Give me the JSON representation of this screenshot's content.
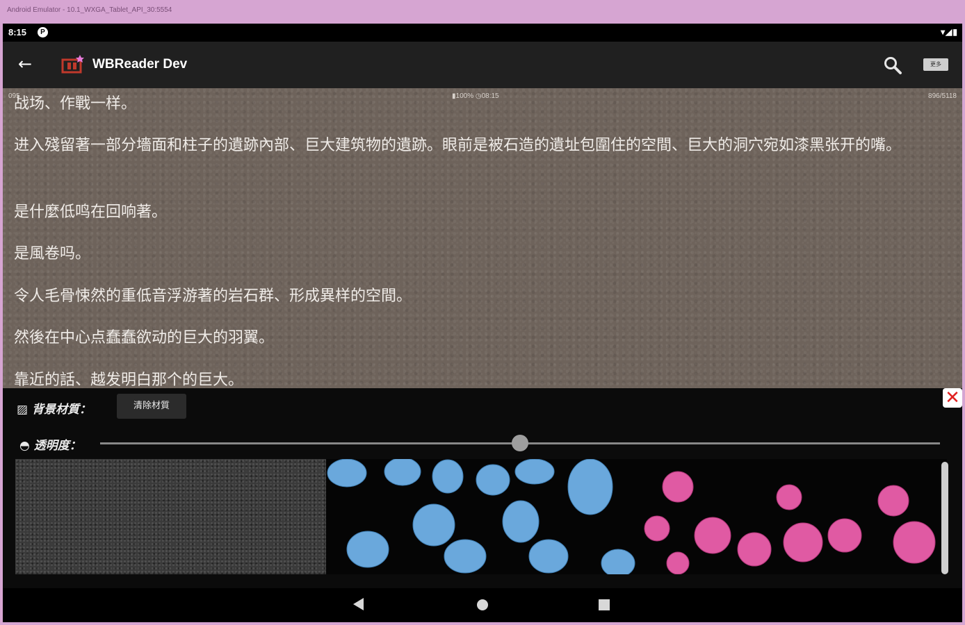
{
  "window": {
    "title": "Android Emulator - 10.1_WXGA_Tablet_API_30:5554"
  },
  "statusbar": {
    "time": "8:15",
    "notification_icon": "P",
    "system_icons": "▾◢▮"
  },
  "appbar": {
    "back_icon": "arrow-left-icon",
    "title": "WBReader Dev",
    "search_icon": "search-icon",
    "more_label": "更多"
  },
  "reader": {
    "meta_left": "095",
    "meta_center": "▮100% ◷08:15",
    "meta_right": "896/5118",
    "paragraphs": [
      "战场、作戰一样。",
      "进入殘留著一部分墻面和柱子的遺跡內部、巨大建筑物的遺跡。眼前是被石造的遺址包圍住的空間、巨大的洞穴宛如漆黑张开的嘴。",
      "是什麼低鸣在回响著。",
      "是風卷吗。",
      "令人毛骨悚然的重低音浮游著的岩石群、形成異样的空間。",
      "然後在中心点蠢蠢欲动的巨大的羽翼。",
      "靠近的話、越发明白那个的巨大。"
    ]
  },
  "panel": {
    "background_label": "▨ 背景材質：",
    "clear_button": "清除材質",
    "opacity_label": "◓ 透明度：",
    "opacity_value": 0.5,
    "close_icon": "close-icon",
    "textures": [
      "gray-texture",
      "blue-petals",
      "pink-flowers"
    ]
  },
  "navbar": {
    "back": "nav-back-icon",
    "home": "nav-home-icon",
    "recent": "nav-recent-icon"
  }
}
